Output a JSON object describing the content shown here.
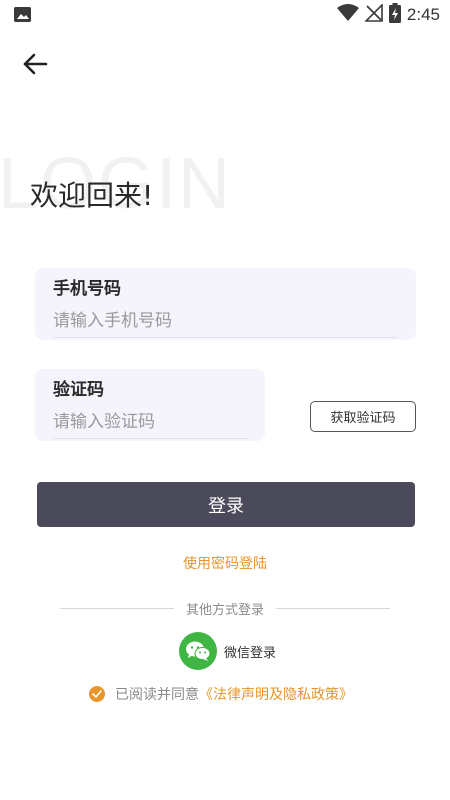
{
  "status_bar": {
    "time": "2:45",
    "icons": [
      "image-icon",
      "wifi-icon",
      "no-signal-icon",
      "battery-charging-icon"
    ]
  },
  "header": {
    "back_icon": "arrow-left-icon",
    "watermark": "LOGIN",
    "title": "欢迎回来!"
  },
  "form": {
    "phone": {
      "label": "手机号码",
      "placeholder": "请输入手机号码",
      "value": ""
    },
    "code": {
      "label": "验证码",
      "placeholder": "请输入验证码",
      "value": ""
    },
    "get_code_label": "获取验证码",
    "login_label": "登录",
    "password_login_label": "使用密码登陆"
  },
  "other_login": {
    "divider_text": "其他方式登录",
    "wechat_label": "微信登录",
    "wechat_icon": "wechat-icon"
  },
  "agreement": {
    "checked": true,
    "prefix": "已阅读并同意",
    "link": "《法律声明及隐私政策》"
  },
  "colors": {
    "accent": "#e8952b",
    "button_dark": "#4a4a5a",
    "panel_bg": "#f5f3fb",
    "wechat_green": "#3fb543"
  }
}
